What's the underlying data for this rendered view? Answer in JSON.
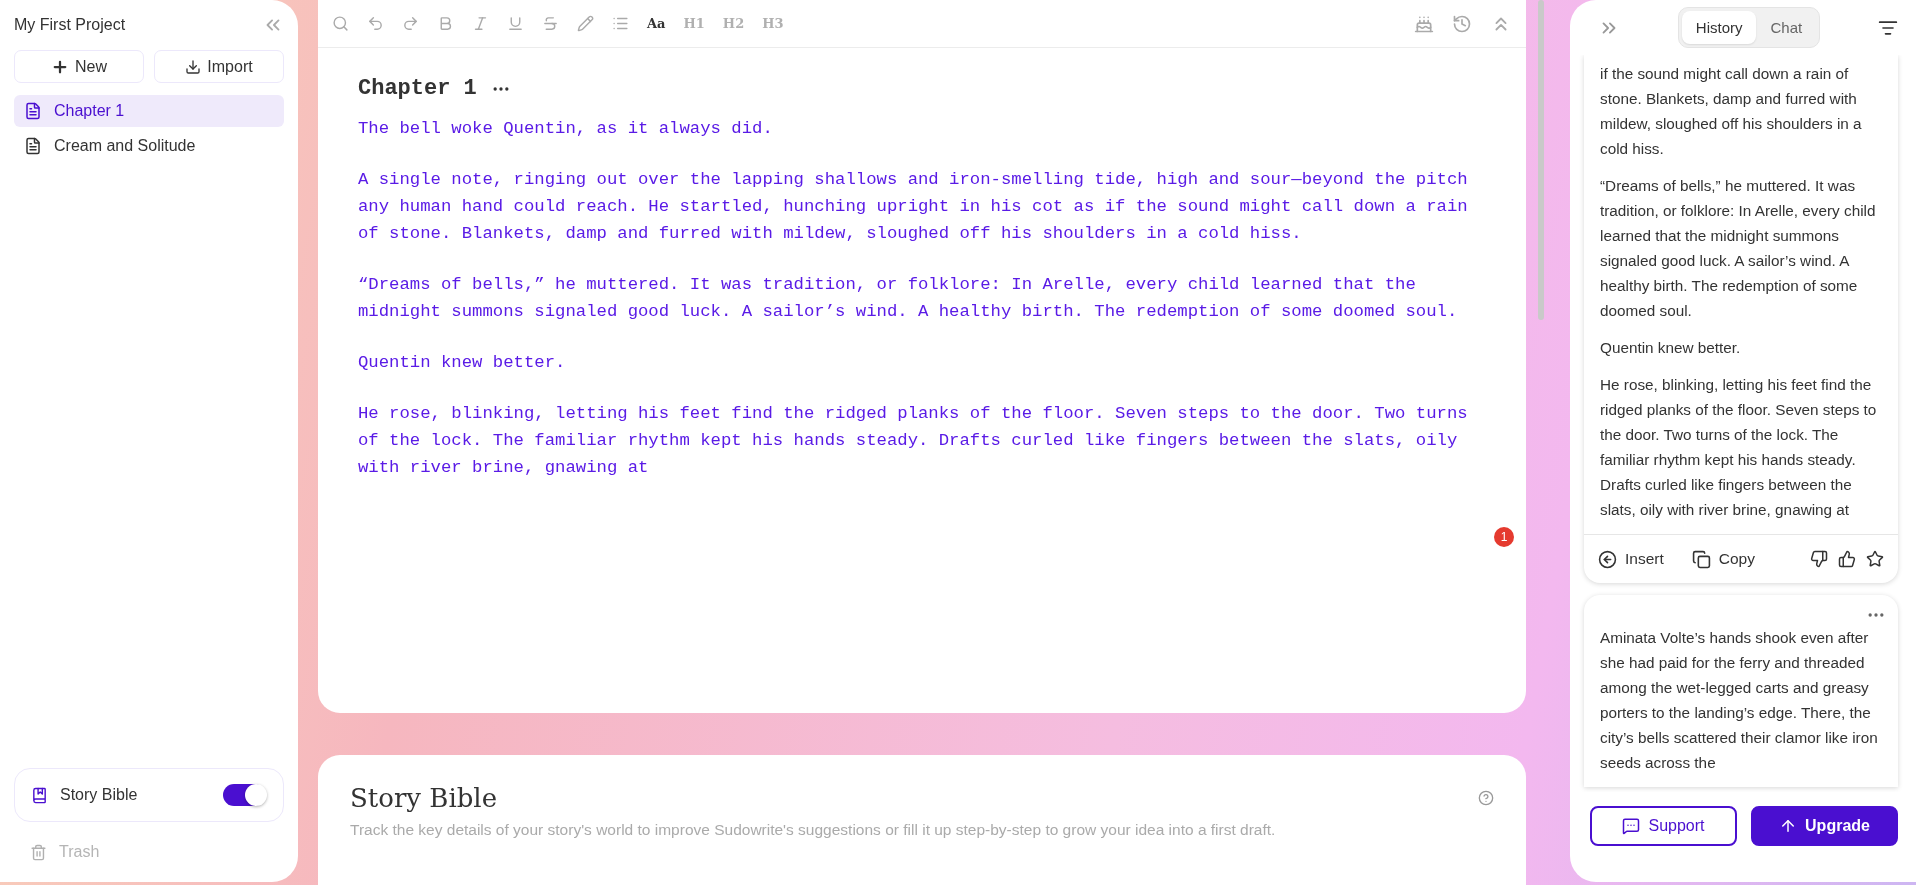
{
  "sidebar": {
    "project_title": "My First Project",
    "new_button": "New",
    "import_button": "Import",
    "documents": [
      {
        "title": "Chapter 1",
        "selected": true
      },
      {
        "title": "Cream and Solitude",
        "selected": false
      }
    ],
    "story_bible_toggle": {
      "label": "Story Bible",
      "on": true
    },
    "trash": "Trash"
  },
  "toolbar": {
    "text_tools": [
      {
        "label": "Aa",
        "active": true
      },
      {
        "label": "H1",
        "active": false
      },
      {
        "label": "H2",
        "active": false
      },
      {
        "label": "H3",
        "active": false
      }
    ]
  },
  "editor": {
    "chapter_title": "Chapter 1",
    "paragraphs": [
      "The bell woke Quentin, as it always did.",
      "A single note, ringing out over the lapping shallows and iron-smelling tide, high and sour—beyond the pitch any human hand could reach. He startled, hunching upright in his cot as if the sound might call down a rain of stone. Blankets, damp and furred with mildew, sloughed off his shoulders in a cold hiss.",
      "“Dreams of bells,” he muttered. It was tradition, or folklore: In Arelle, every child learned that the midnight summons signaled good luck. A sailor’s wind. A healthy birth. The redemption of some doomed soul.",
      "Quentin knew better.",
      "He rose, blinking, letting his feet find the ridged planks of the floor. Seven steps to the door. Two turns of the lock. The familiar rhythm kept his hands steady. Drafts curled like fingers between the slats, oily with river brine, gnawing at"
    ],
    "notification_count": "1"
  },
  "story_bible": {
    "title": "Story Bible",
    "description": "Track the key details of your story's world to improve Sudowrite's suggestions or fill it up step-by-step to grow your idea into a first draft."
  },
  "right_panel": {
    "tabs": [
      {
        "label": "History",
        "selected": true
      },
      {
        "label": "Chat",
        "selected": false
      }
    ],
    "cards": [
      {
        "paragraphs": [
          "if the sound might call down a rain of stone. Blankets, damp and furred with mildew, sloughed off his shoulders in a cold hiss.",
          "“Dreams of bells,” he muttered. It was tradition, or folklore: In Arelle, every child learned that the midnight summons signaled good luck. A sailor’s wind. A healthy birth. The redemption of some doomed soul.",
          "Quentin knew better.",
          "He rose, blinking, letting his feet find the ridged planks of the floor. Seven steps to the door. Two turns of the lock. The familiar rhythm kept his hands steady. Drafts curled like fingers between the slats, oily with river brine, gnawing at"
        ],
        "actions": [
          "Insert",
          "Copy"
        ]
      },
      {
        "menu": true,
        "paragraphs": [
          "Aminata Volte’s hands shook even after she had paid for the ferry and threaded among the wet-legged carts and greasy porters to the landing’s edge. There, the city’s bells scattered their clamor like iron seeds across the"
        ]
      }
    ],
    "support_button": "Support",
    "upgrade_button": "Upgrade"
  }
}
